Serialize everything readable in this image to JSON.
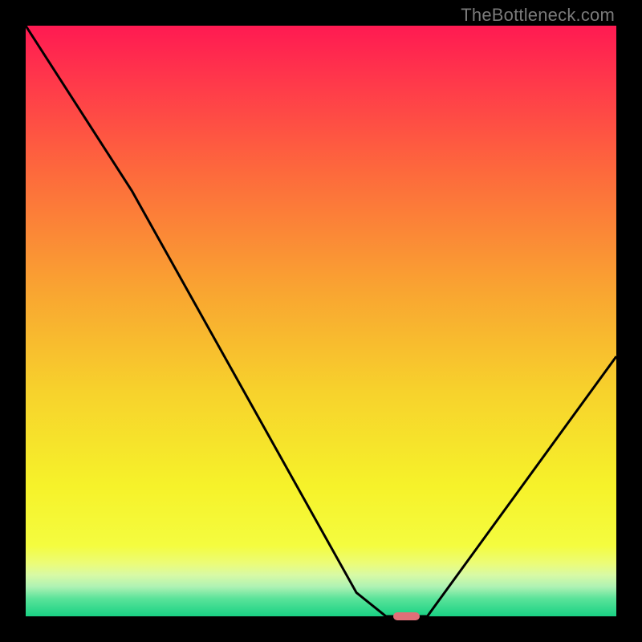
{
  "watermark": "TheBottleneck.com",
  "colors": {
    "curve_stroke": "#000000",
    "marker_fill": "#e16f78",
    "frame_bg": "#000000"
  },
  "gradient_stops": [
    {
      "pct": 0,
      "color": "#ff1a52"
    },
    {
      "pct": 10,
      "color": "#ff3a4a"
    },
    {
      "pct": 25,
      "color": "#fd6a3c"
    },
    {
      "pct": 45,
      "color": "#f9a531"
    },
    {
      "pct": 62,
      "color": "#f7d22c"
    },
    {
      "pct": 78,
      "color": "#f6f22a"
    },
    {
      "pct": 88,
      "color": "#f4fc3f"
    },
    {
      "pct": 91,
      "color": "#ecfc77"
    },
    {
      "pct": 93,
      "color": "#d8faa5"
    },
    {
      "pct": 95,
      "color": "#aef2b4"
    },
    {
      "pct": 97,
      "color": "#5ae39a"
    },
    {
      "pct": 100,
      "color": "#19d184"
    }
  ],
  "chart_data": {
    "type": "line",
    "title": "",
    "xlabel": "",
    "ylabel": "",
    "xlim": [
      0,
      100
    ],
    "ylim": [
      0,
      100
    ],
    "series": [
      {
        "name": "bottleneck-curve",
        "points": [
          {
            "x": 0,
            "y": 100
          },
          {
            "x": 18,
            "y": 72
          },
          {
            "x": 56,
            "y": 4
          },
          {
            "x": 61,
            "y": 0
          },
          {
            "x": 68,
            "y": 0
          },
          {
            "x": 100,
            "y": 44
          }
        ]
      }
    ],
    "marker": {
      "x": 64.5,
      "y": 0,
      "width_pct": 4.5,
      "height_pct": 1.4
    }
  }
}
